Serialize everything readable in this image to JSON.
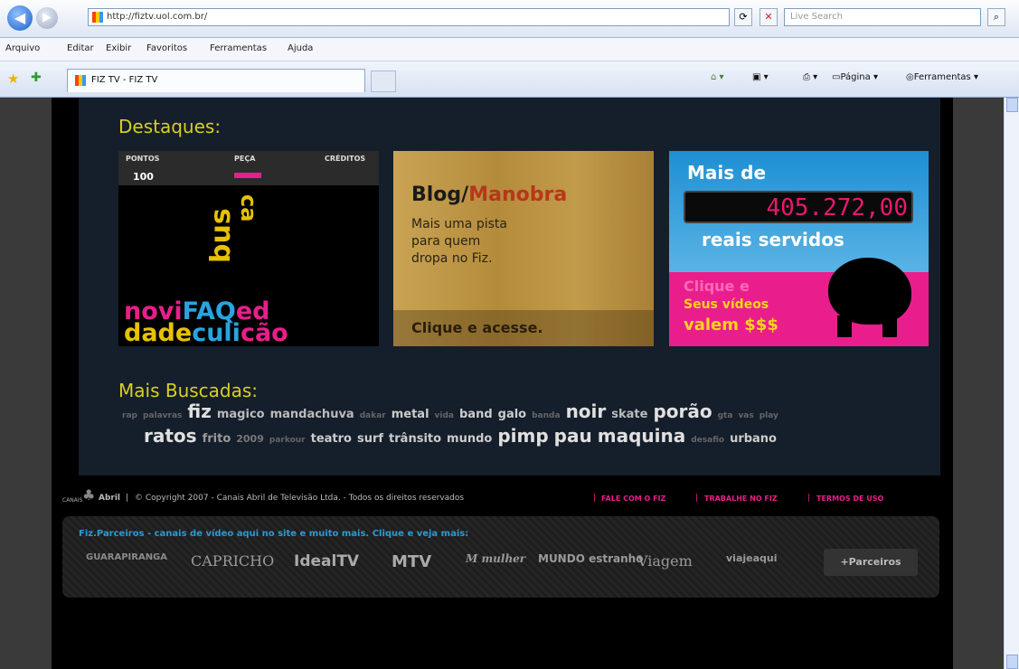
{
  "browser": {
    "url": "http://fiztv.uol.com.br/",
    "search_placeholder": "Live Search",
    "menu": [
      "Arquivo",
      "Editar",
      "Exibir",
      "Favoritos",
      "Ferramentas",
      "Ajuda"
    ],
    "tab_title": "FIZ TV - FIZ TV",
    "tools": {
      "pagina": "Página",
      "ferramentas": "Ferramentas"
    }
  },
  "destaques": {
    "heading": "Destaques:",
    "banner1": {
      "col1": "PONTOS",
      "col2": "PEÇA",
      "col3": "CRÉDITOS",
      "score": "100",
      "word1": "bus",
      "word2": "ca",
      "bottom1": "novi",
      "bottom2": "FAQ",
      "bottom3": "ed",
      "bottom4": "dade",
      "bottom5": "culi",
      "bottom6": "cão"
    },
    "banner2": {
      "title_a": "Blog/",
      "title_b": "Manobra",
      "body1": "Mais uma pista",
      "body2": "para quem",
      "body3": "dropa no Fiz.",
      "cta": "Clique e acesse."
    },
    "banner3": {
      "line1": "Mais de",
      "counter": "405.272,00",
      "line2": "reais servidos",
      "cta1": "Clique e",
      "cta2": "Seus vídeos",
      "cta3": "valem $$$"
    }
  },
  "buscadas": {
    "heading": "Mais Buscadas:",
    "row1": [
      {
        "t": "rap",
        "s": 9,
        "c": "#666"
      },
      {
        "t": "palavras",
        "s": 9,
        "c": "#666"
      },
      {
        "t": "fiz",
        "s": 20,
        "c": "#e0e0e0"
      },
      {
        "t": "magico",
        "s": 13,
        "c": "#bbb"
      },
      {
        "t": "mandachuva",
        "s": 13,
        "c": "#bbb"
      },
      {
        "t": "dakar",
        "s": 9,
        "c": "#666"
      },
      {
        "t": "metal",
        "s": 13,
        "c": "#ccc"
      },
      {
        "t": "vida",
        "s": 9,
        "c": "#666"
      },
      {
        "t": "band",
        "s": 13,
        "c": "#ccc"
      },
      {
        "t": "galo",
        "s": 13,
        "c": "#ccc"
      },
      {
        "t": "banda",
        "s": 9,
        "c": "#666"
      },
      {
        "t": "noir",
        "s": 20,
        "c": "#e0e0e0"
      },
      {
        "t": "skate",
        "s": 13,
        "c": "#bbb"
      },
      {
        "t": "porão",
        "s": 20,
        "c": "#e0e0e0"
      },
      {
        "t": "gta",
        "s": 9,
        "c": "#666"
      },
      {
        "t": "vas",
        "s": 9,
        "c": "#666"
      },
      {
        "t": "play",
        "s": 9,
        "c": "#666"
      }
    ],
    "row2": [
      {
        "t": "ratos",
        "s": 20,
        "c": "#e0e0e0"
      },
      {
        "t": "frito",
        "s": 13,
        "c": "#999"
      },
      {
        "t": "2009",
        "s": 11,
        "c": "#777"
      },
      {
        "t": "parkour",
        "s": 9,
        "c": "#666"
      },
      {
        "t": "teatro",
        "s": 13,
        "c": "#ccc"
      },
      {
        "t": "surf",
        "s": 13,
        "c": "#ccc"
      },
      {
        "t": "trânsito",
        "s": 13,
        "c": "#ccc"
      },
      {
        "t": "mundo",
        "s": 13,
        "c": "#ccc"
      },
      {
        "t": "pimp",
        "s": 20,
        "c": "#e0e0e0"
      },
      {
        "t": "pau",
        "s": 20,
        "c": "#e0e0e0"
      },
      {
        "t": "maquina",
        "s": 20,
        "c": "#e0e0e0"
      },
      {
        "t": "desafio",
        "s": 9,
        "c": "#666"
      },
      {
        "t": "urbano",
        "s": 13,
        "c": "#ccc"
      }
    ]
  },
  "footer": {
    "brand_small": "CANAIS",
    "brand": "Abril",
    "copyright": "© Copyright 2007 - Canais Abril de Televisão Ltda. - Todos os direitos reservados",
    "links": [
      "FALE COM O FIZ",
      "TRABALHE NO FIZ",
      "TERMOS DE USO"
    ]
  },
  "partners": {
    "title": "Fiz.Parceiros  -  canais de vídeo aqui no site e muito mais. Clique e veja mais:",
    "logos": [
      "GUARAPIRANGA",
      "CAPRICHO",
      "IdealTV",
      "MTV",
      "M mulher",
      "MUNDO estranho",
      "Viagem",
      "viajeaqui"
    ],
    "more": "+Parceiros"
  },
  "colors": {
    "accent": "#d8d11c",
    "pink": "#e91e8c",
    "panel": "#151e2b"
  }
}
